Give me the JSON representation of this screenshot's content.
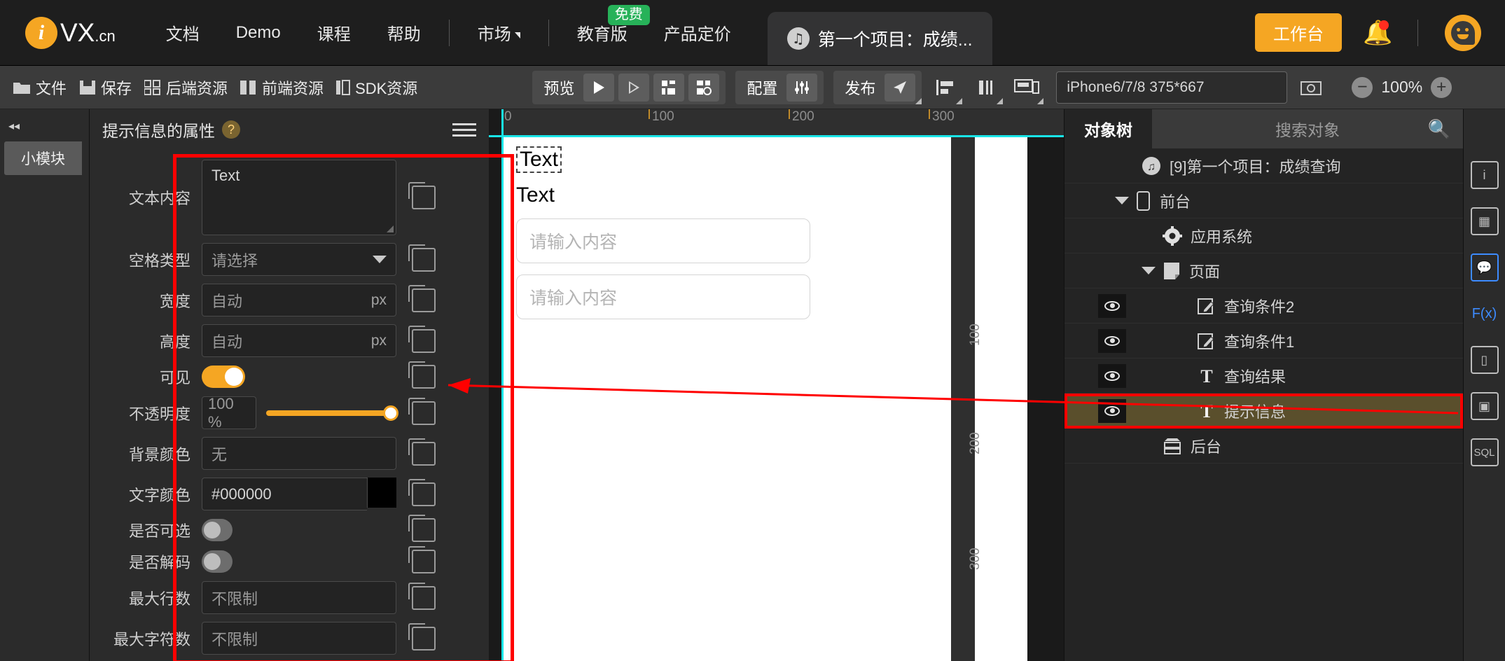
{
  "topnav": {
    "logo_text": "VX",
    "logo_suffix": ".cn",
    "logo_mark": "i",
    "items": [
      {
        "label": "文档"
      },
      {
        "label": "Demo"
      },
      {
        "label": "课程"
      },
      {
        "label": "帮助"
      },
      {
        "label": "市场"
      },
      {
        "label": "教育版"
      },
      {
        "label": "产品定价"
      }
    ],
    "free_badge": "免费",
    "project_tab": "第一个项目：成绩...",
    "workbench_button": "工作台"
  },
  "toolbar": {
    "file": "文件",
    "save": "保存",
    "backend_res": "后端资源",
    "frontend_res": "前端资源",
    "sdk_res": "SDK资源",
    "preview": "预览",
    "config": "配置",
    "publish": "发布",
    "device": "iPhone6/7/8 375*667",
    "zoom": "100%"
  },
  "mini_sidebar": {
    "collapse": "◂◂",
    "tab": "小模块"
  },
  "properties": {
    "title": "提示信息的属性",
    "help": "?",
    "rows": [
      {
        "label": "文本内容",
        "value": "Text",
        "type": "textarea",
        "copy": true
      },
      {
        "label": "空格类型",
        "value": "请选择",
        "type": "select",
        "copy": true
      },
      {
        "label": "宽度",
        "value": "自动",
        "unit": "px",
        "type": "input",
        "copy": true
      },
      {
        "label": "高度",
        "value": "自动",
        "unit": "px",
        "type": "input",
        "copy": true
      },
      {
        "label": "可见",
        "value": "on",
        "type": "toggle",
        "copy": true
      },
      {
        "label": "不透明度",
        "value": "100 %",
        "type": "opacity",
        "copy": true
      },
      {
        "label": "背景颜色",
        "value": "无",
        "type": "input",
        "copy": true
      },
      {
        "label": "文字颜色",
        "value": "#000000",
        "type": "color",
        "swatch": "#000000",
        "copy": true
      },
      {
        "label": "是否可选",
        "value": "off",
        "type": "toggle",
        "copy": true
      },
      {
        "label": "是否解码",
        "value": "off",
        "type": "toggle",
        "copy": true
      },
      {
        "label": "最大行数",
        "value": "不限制",
        "type": "input",
        "copy": true
      },
      {
        "label": "最大字符数",
        "value": "不限制",
        "type": "input",
        "copy": true
      }
    ]
  },
  "canvas": {
    "ruler_h": [
      "0",
      "100",
      "200",
      "300"
    ],
    "ruler_v": [
      "100",
      "200",
      "300"
    ],
    "texts": [
      "Text",
      "Text"
    ],
    "inputs": [
      "请输入内容",
      "请输入内容"
    ]
  },
  "object_tree": {
    "tab_tree": "对象树",
    "tab_search": "搜索对象",
    "nodes": [
      {
        "label": "[9]第一个项目：成绩查询",
        "icon": "project-icon",
        "indent": 0,
        "eye": false,
        "tri": false,
        "selected": false
      },
      {
        "label": "前台",
        "icon": "phone-icon",
        "indent": 1,
        "eye": false,
        "tri": true,
        "selected": false
      },
      {
        "label": "应用系统",
        "icon": "gear-icon",
        "indent": 2,
        "eye": false,
        "tri": false,
        "selected": false
      },
      {
        "label": "页面",
        "icon": "page-icon",
        "indent": 2,
        "eye": false,
        "tri": true,
        "selected": false
      },
      {
        "label": "查询条件2",
        "icon": "edit-icon",
        "indent": 3,
        "eye": true,
        "tri": false,
        "selected": false
      },
      {
        "label": "查询条件1",
        "icon": "edit-icon",
        "indent": 3,
        "eye": true,
        "tri": false,
        "selected": false
      },
      {
        "label": "查询结果",
        "icon": "text-icon",
        "indent": 3,
        "eye": true,
        "tri": false,
        "selected": false
      },
      {
        "label": "提示信息",
        "icon": "text-icon",
        "indent": 3,
        "eye": true,
        "tri": false,
        "selected": true
      },
      {
        "label": "后台",
        "icon": "server-icon",
        "indent": 2,
        "eye": false,
        "tri": false,
        "selected": false
      }
    ]
  },
  "rail": {
    "items": [
      "info-icon",
      "layers-icon",
      "chat-icon",
      "fx-icon",
      "device-icon",
      "copy-icon",
      "sql-icon"
    ],
    "fx_label": "F(x)",
    "sql_label": "SQL"
  },
  "accent": {
    "orange": "#f5a623",
    "red": "#ff0000",
    "green": "#27b259",
    "cyan": "#19e5e8"
  }
}
